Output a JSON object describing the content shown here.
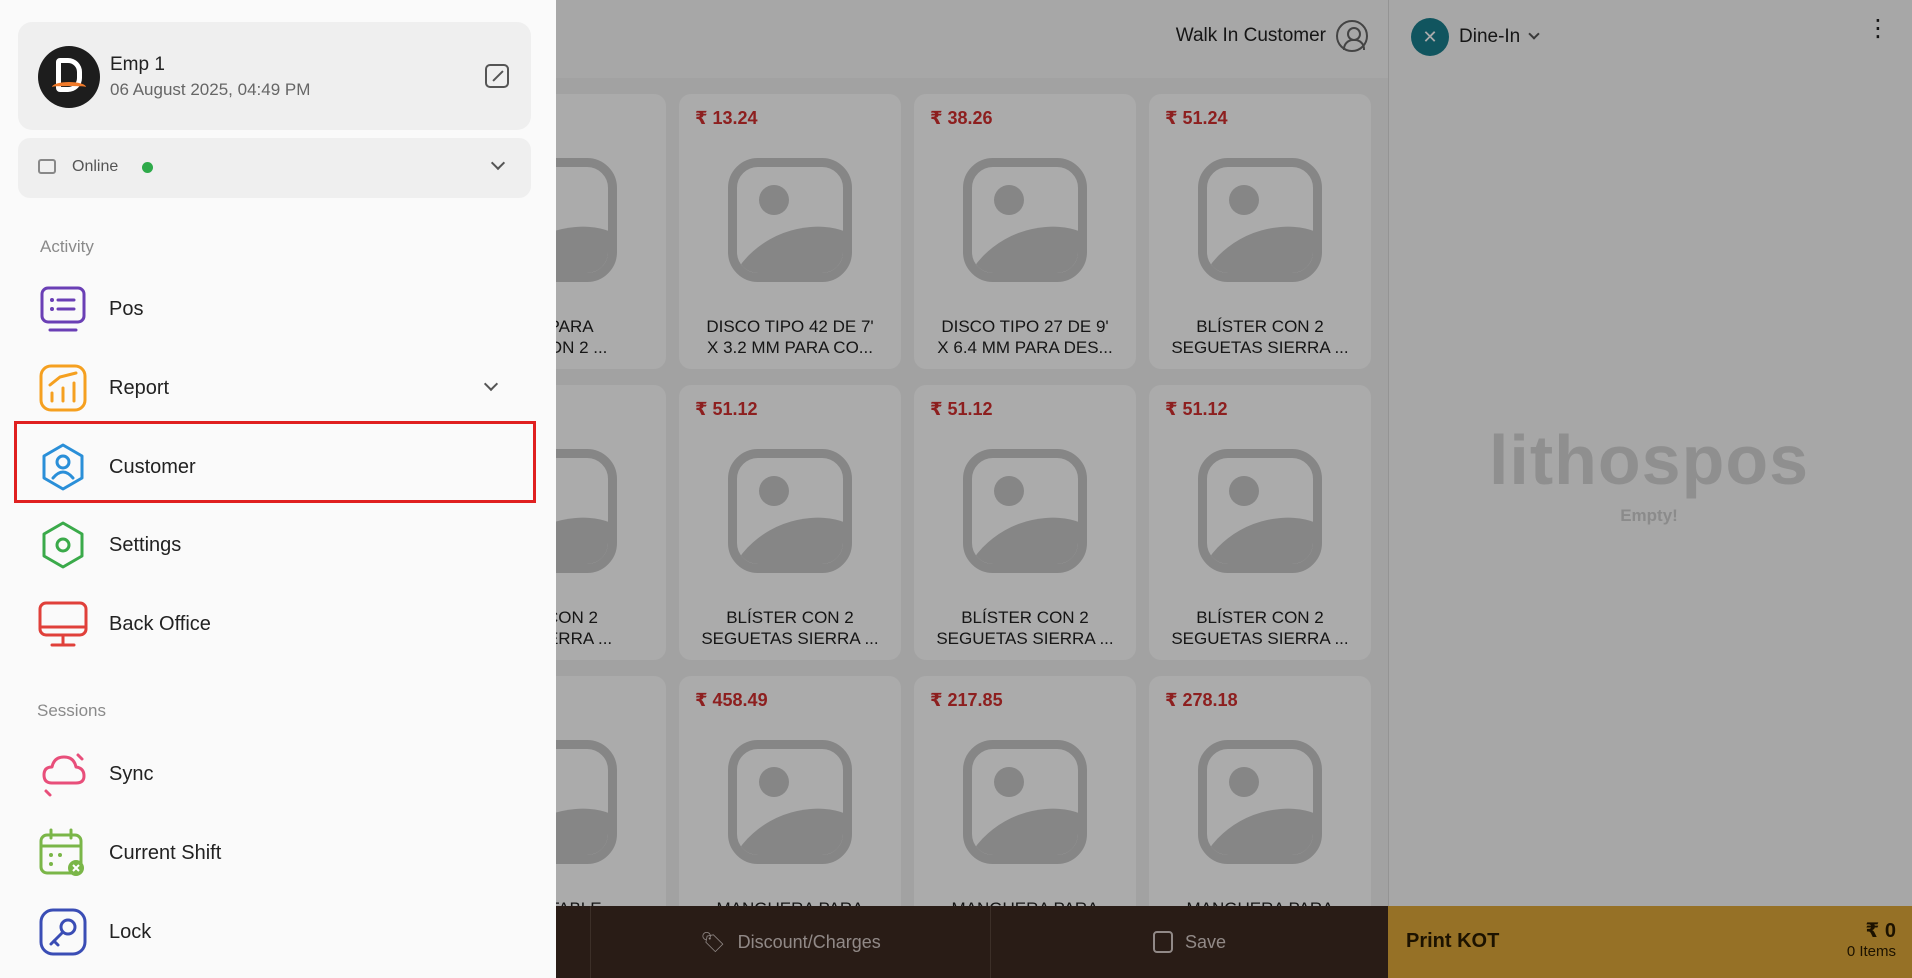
{
  "pos": {
    "customer": "Walk In Customer",
    "order_type": "Dine-In",
    "products": [
      {
        "price": "",
        "name": "…A PARA\n…R CON 2 ..."
      },
      {
        "price": "₹ 13.24",
        "name": "DISCO TIPO 42 DE 7'\nX 3.2 MM PARA CO..."
      },
      {
        "price": "₹ 38.26",
        "name": "DISCO TIPO 27 DE 9'\nX 6.4 MM PARA DES..."
      },
      {
        "price": "₹ 51.24",
        "name": "BLÍSTER CON 2\nSEGUETAS SIERRA ..."
      },
      {
        "price": "",
        "name": "…R CON 2\n…S SIERRA ..."
      },
      {
        "price": "₹ 51.12",
        "name": "BLÍSTER CON 2\nSEGUETAS SIERRA ..."
      },
      {
        "price": "₹ 51.12",
        "name": "BLÍSTER CON 2\nSEGUETAS SIERRA ..."
      },
      {
        "price": "₹ 51.12",
        "name": "BLÍSTER CON 2\nSEGUETAS SIERRA ..."
      },
      {
        "price": "",
        "name": "…USTABLE"
      },
      {
        "price": "₹ 458.49",
        "name": "MANGUERA PARA"
      },
      {
        "price": "₹ 217.85",
        "name": "MANGUERA PARA"
      },
      {
        "price": "₹ 278.18",
        "name": "MANGUERA PARA"
      }
    ],
    "brand": "lithospos",
    "cart_empty": "Empty!",
    "bottom": {
      "discount": "Discount/Charges",
      "save": "Save",
      "print_kot": "Print KOT",
      "total": "₹ 0",
      "items": "0 Items"
    }
  },
  "drawer": {
    "profile": {
      "name": "Emp 1",
      "datetime": "06 August 2025, 04:49 PM"
    },
    "status": "Online",
    "sections": {
      "activity": "Activity",
      "sessions": "Sessions"
    },
    "activity_items": [
      "Pos",
      "Report",
      "Customer",
      "Settings",
      "Back Office"
    ],
    "session_items": [
      "Sync",
      "Current Shift",
      "Lock"
    ],
    "colors": {
      "pos": "#6a3fb5",
      "report": "#f5a020",
      "customer": "#2a8fd8",
      "settings": "#3aaa4a",
      "back_office": "#e0403a",
      "sync": "#e84e7a",
      "current_shift": "#7ab648",
      "lock": "#3a4db5",
      "highlight": "#e02020"
    }
  }
}
